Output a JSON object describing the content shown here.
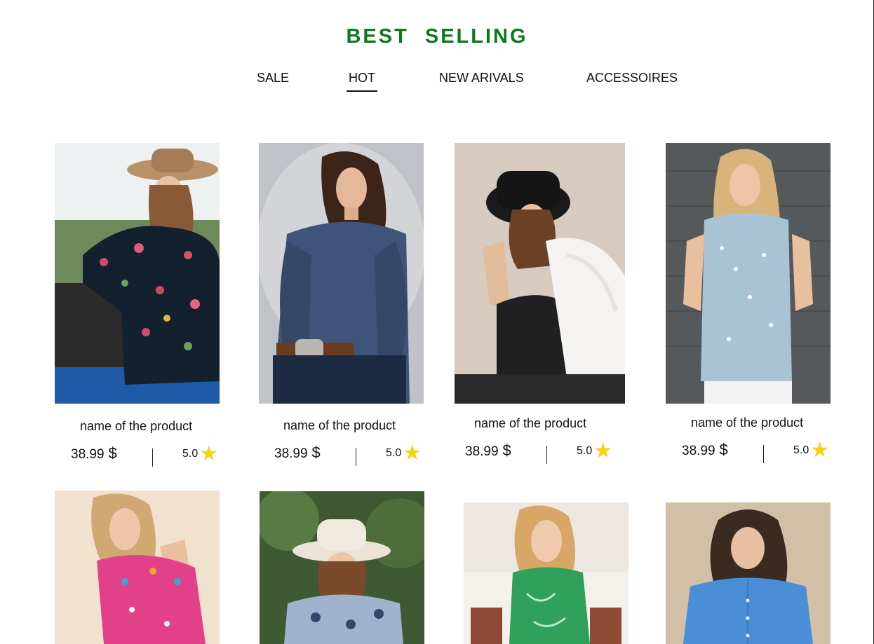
{
  "section": {
    "title": "BEST SELLING"
  },
  "tabs": [
    {
      "label": "SALE",
      "active": false
    },
    {
      "label": "HOT",
      "active": true
    },
    {
      "label": "NEW ARIVALS",
      "active": false
    },
    {
      "label": "ACCESSOIRES",
      "active": false
    }
  ],
  "products": [
    {
      "name": "name of the product",
      "price": "38.99",
      "currency": "$",
      "rating": "5.0",
      "image": "woman in floral black shirt and tan hat"
    },
    {
      "name": "name of the product",
      "price": "38.99",
      "currency": "$",
      "rating": "5.0",
      "image": "woman in blue denim western shirt"
    },
    {
      "name": "name of the product",
      "price": "38.99",
      "currency": "$",
      "rating": "5.0",
      "image": "woman in black hat with white fur coat"
    },
    {
      "name": "name of the product",
      "price": "38.99",
      "currency": "$",
      "rating": "5.0",
      "image": "woman in light blue floral blouse"
    },
    {
      "image": "woman in pink embroidered blouse"
    },
    {
      "image": "woman in white cowboy hat and blue floral top"
    },
    {
      "image": "woman in green patterned top"
    },
    {
      "image": "woman in blue denim shirt"
    }
  ],
  "colors": {
    "title": "#0b7a1c",
    "star": "#f5d21a"
  },
  "icons": {
    "rating": "star-icon"
  }
}
